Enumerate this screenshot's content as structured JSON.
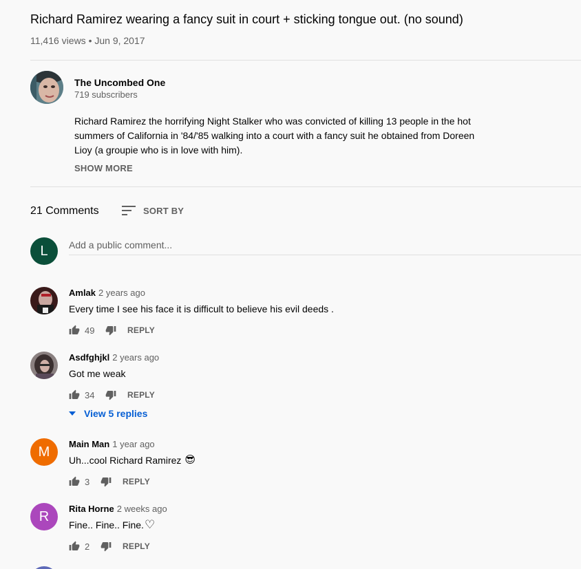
{
  "video": {
    "title": "Richard Ramirez wearing a fancy suit in court + sticking tongue out. (no sound)",
    "meta": "11,416 views • Jun 9, 2017"
  },
  "channel": {
    "name": "The Uncombed One",
    "subscribers": "719 subscribers",
    "description": "Richard Ramirez the horrifying Night Stalker who was convicted of killing 13 people in the hot summers of California in '84/'85 walking into a court with a fancy suit he obtained from Doreen Lioy (a groupie who is in love with him).",
    "show_more": "SHOW MORE"
  },
  "comments_section": {
    "count_label": "21 Comments",
    "sort_label": "SORT BY",
    "user_initial": "L",
    "placeholder": "Add a public comment..."
  },
  "comments": [
    {
      "author": "Amlak",
      "time": "2 years ago",
      "text": "Every time I see his face it is difficult to believe his evil deeds .",
      "likes": "49",
      "reply": "REPLY",
      "avatar_color": "#3a1a1a"
    },
    {
      "author": "Asdfghjkl",
      "time": "2 years ago",
      "text": "Got me weak",
      "likes": "34",
      "reply": "REPLY",
      "view_replies": "View 5 replies",
      "avatar_color": "#6d5d5d"
    },
    {
      "author": "Main Man",
      "time": "1 year ago",
      "text": "Uh...cool Richard Ramirez",
      "emoji": "😎",
      "likes": "3",
      "reply": "REPLY",
      "initial": "M",
      "avatar_color": "#ef6c00"
    },
    {
      "author": "Rita Horne",
      "time": "2 weeks ago",
      "text": "Fine.. Fine.. Fine.",
      "emoji": "♡",
      "likes": "2",
      "reply": "REPLY",
      "initial": "R",
      "avatar_color": "#ab47bc"
    }
  ],
  "colors": {
    "link_blue": "#065fd4",
    "secondary_text": "#606060",
    "background": "#f9f9f9"
  }
}
